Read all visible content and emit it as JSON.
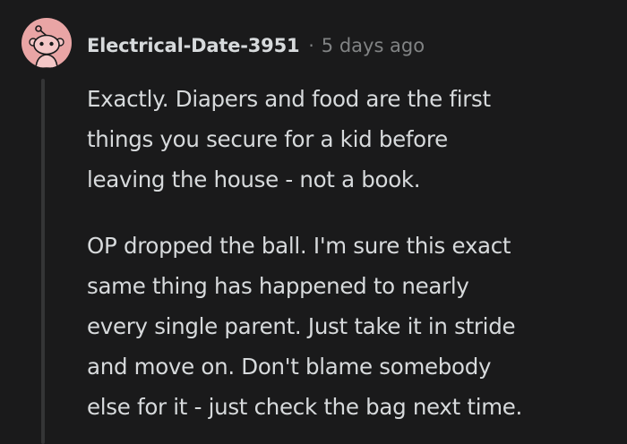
{
  "comment": {
    "username": "Electrical-Date-3951",
    "separator": "·",
    "timestamp": "5 days ago",
    "avatar_icon": "reddit-snoo-icon",
    "paragraphs": [
      {
        "lines": [
          "Exactly. Diapers and food are the first",
          "things you secure for a kid before",
          "leaving the house - not a book."
        ]
      },
      {
        "lines": [
          "OP dropped the ball. I'm sure this exact",
          "same thing has happened to nearly",
          "every single parent. Just take it in stride",
          "and move on. Don't blame somebody",
          "else for it - just check the bag next time."
        ]
      }
    ]
  },
  "colors": {
    "background": "#1a1a1b",
    "text": "#d7dadc",
    "meta": "#818384",
    "avatar_bg": "#e9a5a5",
    "thread_line": "#343536"
  }
}
